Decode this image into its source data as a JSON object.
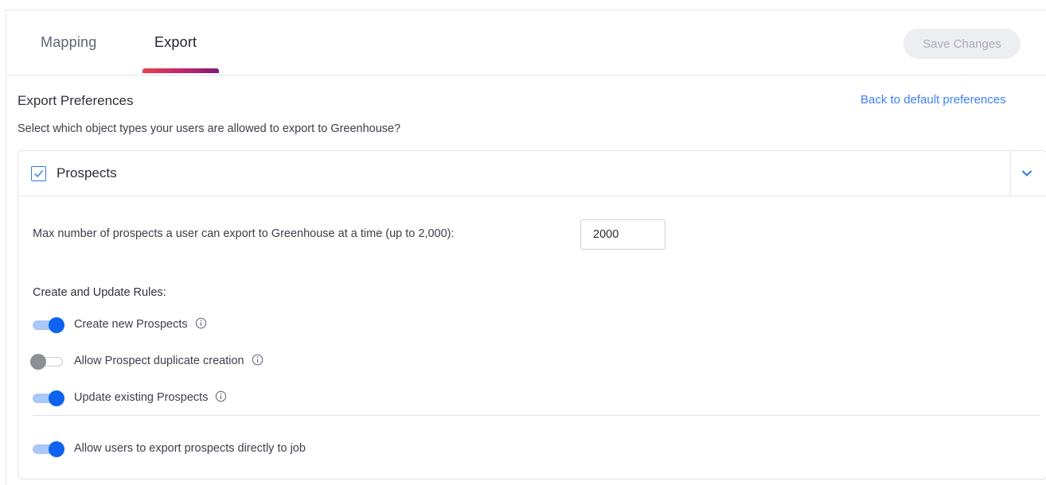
{
  "tabs": [
    {
      "label": "Mapping",
      "active": false
    },
    {
      "label": "Export",
      "active": true
    }
  ],
  "toolbar": {
    "save_label": "Save Changes"
  },
  "section": {
    "title": "Export Preferences",
    "reset_link": "Back to default preferences",
    "question": "Select which object types your users are allowed to export to Greenhouse?"
  },
  "card": {
    "title": "Prospects",
    "checked": true,
    "max_label": "Max number of prospects a user can export to Greenhouse at a time (up to 2,000):",
    "max_value": "2000",
    "rules_heading": "Create and Update Rules:",
    "rules": [
      {
        "label": "Create new Prospects",
        "enabled": true,
        "info": true
      },
      {
        "label": "Allow Prospect duplicate creation",
        "enabled": false,
        "info": true
      },
      {
        "label": "Update existing Prospects",
        "enabled": true,
        "info": true
      }
    ],
    "extra_rule": {
      "label": "Allow users to export prospects directly to job",
      "enabled": true
    }
  },
  "colors": {
    "accent": "#0d63f0",
    "link": "#3b82f6",
    "tab_underline_start": "#e8414f",
    "tab_underline_end": "#7a1e7d"
  },
  "icons": {
    "checkbox": "check-icon",
    "expand": "chevron-down-icon",
    "info": "info-circle-icon"
  }
}
